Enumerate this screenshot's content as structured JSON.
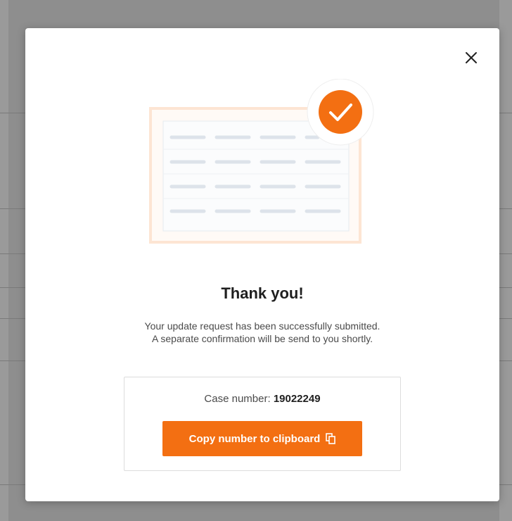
{
  "modal": {
    "title": "Thank you!",
    "message_line1": "Your update request has been successfully submitted.",
    "message_line2": "A separate confirmation will be send to you shortly.",
    "case_label": "Case number:",
    "case_number": "19022249",
    "copy_button_label": "Copy number to clipboard",
    "close_icon": "close-icon",
    "copy_icon": "copy-icon",
    "illustration_icon": "check-icon"
  },
  "colors": {
    "accent": "#f36f12",
    "illustration_border": "#fde5d3",
    "placeholder_line": "#dde3ea",
    "backdrop": "#8e8e8e"
  }
}
